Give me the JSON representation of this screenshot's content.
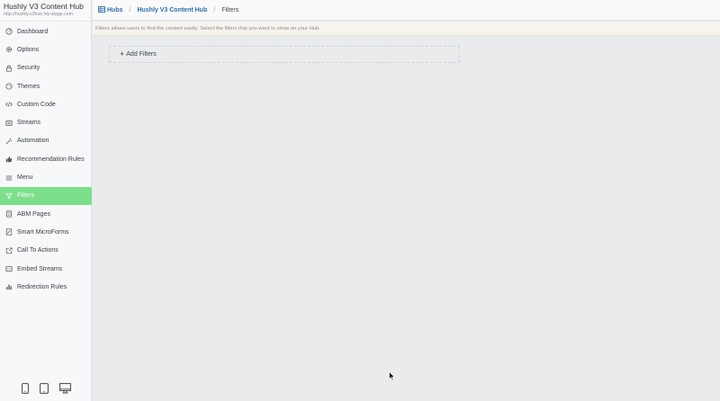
{
  "sidebar": {
    "title": "Hushly V3 Content Hub",
    "url": "http://hushly.v3hub.hly-stage.com",
    "items": [
      {
        "label": "Dashboard",
        "icon": "dashboard-icon"
      },
      {
        "label": "Options",
        "icon": "gear-icon"
      },
      {
        "label": "Security",
        "icon": "lock-icon"
      },
      {
        "label": "Themes",
        "icon": "palette-icon"
      },
      {
        "label": "Custom Code",
        "icon": "code-icon"
      },
      {
        "label": "Streams",
        "icon": "streams-icon"
      },
      {
        "label": "Automation",
        "icon": "magic-wand-icon"
      },
      {
        "label": "Recommendation Rules",
        "icon": "thumbs-up-icon"
      },
      {
        "label": "Menu",
        "icon": "menu-icon"
      },
      {
        "label": "Filters",
        "icon": "filter-icon",
        "active": true
      },
      {
        "label": "ABM Pages",
        "icon": "document-icon"
      },
      {
        "label": "Smart MicroForms",
        "icon": "form-icon"
      },
      {
        "label": "Call To Actions",
        "icon": "external-link-icon"
      },
      {
        "label": "Embed Streams",
        "icon": "embed-icon"
      },
      {
        "label": "Redirection Rules",
        "icon": "bar-chart-icon"
      }
    ],
    "devices": [
      "mobile-icon",
      "tablet-icon",
      "desktop-icon"
    ]
  },
  "breadcrumb": {
    "hubs": "Hubs",
    "hub": "Hushly V3 Content Hub",
    "current": "Filters"
  },
  "info": "Filters allows users to find the content easily. Select the filters that you want to show on your Hub.",
  "add_filters": "Add Filters",
  "colors": {
    "active": "#7ddf8c",
    "link": "#2f6fa8",
    "background": "#e9ebed"
  }
}
